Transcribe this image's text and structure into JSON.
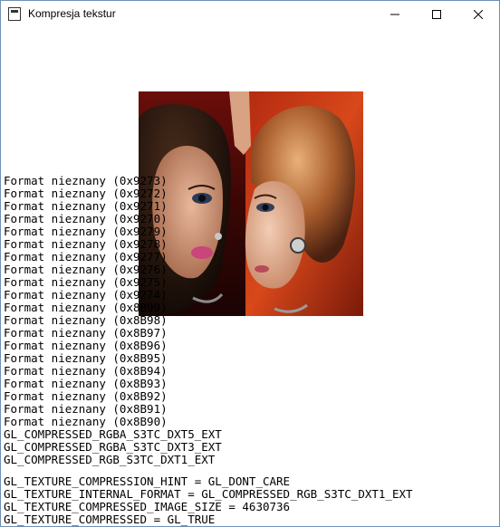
{
  "window": {
    "title": "Kompresja tekstur",
    "controls": [
      "minimize",
      "maximize",
      "close"
    ]
  },
  "texture": {
    "icon": "texture-image"
  },
  "formats": [
    "Format nieznany (0x9273)",
    "Format nieznany (0x9272)",
    "Format nieznany (0x9271)",
    "Format nieznany (0x9270)",
    "Format nieznany (0x9279)",
    "Format nieznany (0x9278)",
    "Format nieznany (0x9277)",
    "Format nieznany (0x9276)",
    "Format nieznany (0x9275)",
    "Format nieznany (0x9274)",
    "Format nieznany (0x8B99)",
    "Format nieznany (0x8B98)",
    "Format nieznany (0x8B97)",
    "Format nieznany (0x8B96)",
    "Format nieznany (0x8B95)",
    "Format nieznany (0x8B94)",
    "Format nieznany (0x8B93)",
    "Format nieznany (0x8B92)",
    "Format nieznany (0x8B91)",
    "Format nieznany (0x8B90)",
    "GL_COMPRESSED_RGBA_S3TC_DXT5_EXT",
    "GL_COMPRESSED_RGBA_S3TC_DXT3_EXT",
    "GL_COMPRESSED_RGB_S3TC_DXT1_EXT"
  ],
  "params": [
    "GL_TEXTURE_COMPRESSION_HINT = GL_DONT_CARE",
    "GL_TEXTURE_INTERNAL_FORMAT = GL_COMPRESSED_RGB_S3TC_DXT1_EXT",
    "GL_TEXTURE_COMPRESSED_IMAGE_SIZE = 4630736",
    "GL_TEXTURE_COMPRESSED = GL_TRUE"
  ]
}
